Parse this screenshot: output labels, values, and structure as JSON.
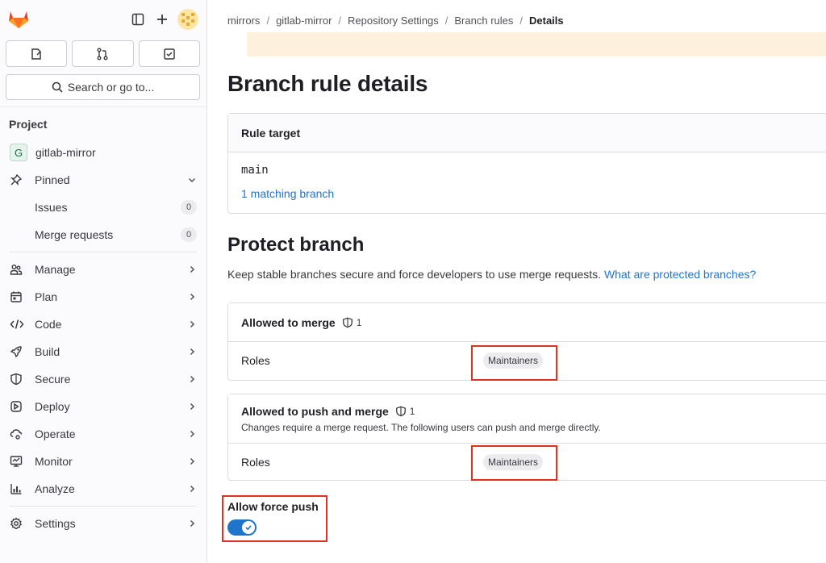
{
  "sidebar": {
    "search_label": "Search or go to...",
    "section_title": "Project",
    "project_initial": "G",
    "project_name": "gitlab-mirror",
    "pinned_label": "Pinned",
    "pinned_items": [
      {
        "label": "Issues",
        "count": "0"
      },
      {
        "label": "Merge requests",
        "count": "0"
      }
    ],
    "nav": [
      {
        "label": "Manage",
        "icon": "users-icon"
      },
      {
        "label": "Plan",
        "icon": "calendar-icon"
      },
      {
        "label": "Code",
        "icon": "code-icon"
      },
      {
        "label": "Build",
        "icon": "rocket-icon"
      },
      {
        "label": "Secure",
        "icon": "shield-icon"
      },
      {
        "label": "Deploy",
        "icon": "deploy-icon"
      },
      {
        "label": "Operate",
        "icon": "cloud-gear-icon"
      },
      {
        "label": "Monitor",
        "icon": "monitor-icon"
      },
      {
        "label": "Analyze",
        "icon": "chart-icon"
      }
    ],
    "settings_label": "Settings"
  },
  "breadcrumb": [
    "mirrors",
    "gitlab-mirror",
    "Repository Settings",
    "Branch rules",
    "Details"
  ],
  "page_title": "Branch rule details",
  "rule_target": {
    "heading": "Rule target",
    "branch": "main",
    "matching": "1 matching branch"
  },
  "protect": {
    "heading": "Protect branch",
    "description": "Keep stable branches secure and force developers to use merge requests.",
    "help_link": "What are protected branches?",
    "merge": {
      "title": "Allowed to merge",
      "count": "1",
      "roles_label": "Roles",
      "role": "Maintainers"
    },
    "push": {
      "title": "Allowed to push and merge",
      "count": "1",
      "subtitle": "Changes require a merge request. The following users can push and merge directly.",
      "roles_label": "Roles",
      "role": "Maintainers"
    },
    "force_push": {
      "label": "Allow force push",
      "enabled": true
    }
  },
  "colors": {
    "accent": "#1f75cb",
    "highlight": "#e0301e",
    "banner": "#fdf1dd"
  }
}
